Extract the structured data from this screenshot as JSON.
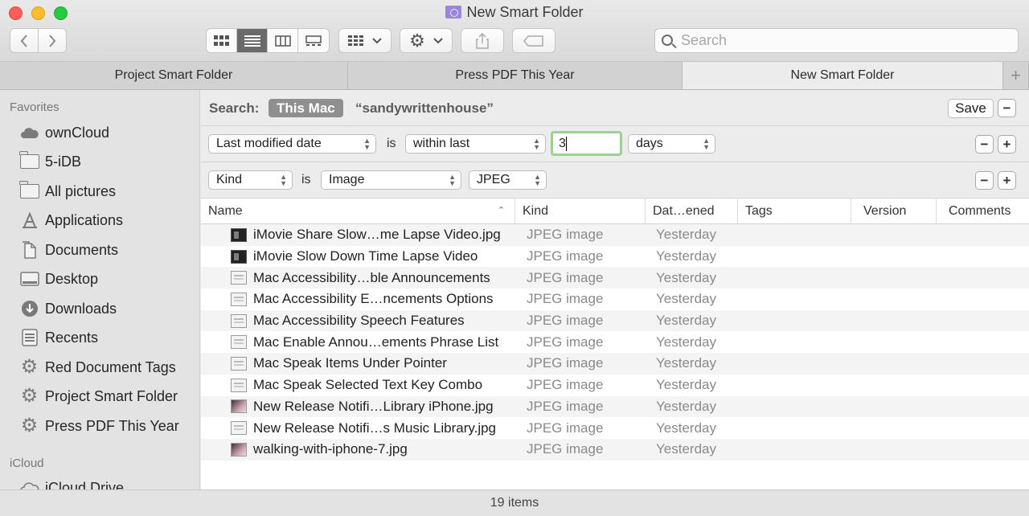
{
  "window": {
    "title": "New Smart Folder"
  },
  "toolbar": {
    "back_icon": "chevron-left-icon",
    "forward_icon": "chevron-right-icon",
    "view_modes": [
      "icon-view",
      "list-view",
      "column-view",
      "gallery-view"
    ],
    "active_view": "list-view",
    "search_placeholder": "Search"
  },
  "tabs": [
    {
      "label": "Project Smart Folder",
      "active": false
    },
    {
      "label": "Press PDF This Year",
      "active": false
    },
    {
      "label": "New Smart Folder",
      "active": true
    }
  ],
  "sidebar": {
    "favorites_header": "Favorites",
    "items": [
      {
        "label": "ownCloud",
        "icon": "cloud-icon"
      },
      {
        "label": "5-iDB",
        "icon": "folder-icon"
      },
      {
        "label": "All pictures",
        "icon": "folder-icon"
      },
      {
        "label": "Applications",
        "icon": "applications-icon"
      },
      {
        "label": "Documents",
        "icon": "document-icon"
      },
      {
        "label": "Desktop",
        "icon": "desktop-icon"
      },
      {
        "label": "Downloads",
        "icon": "download-icon"
      },
      {
        "label": "Recents",
        "icon": "recents-icon"
      },
      {
        "label": "Red Document Tags",
        "icon": "gear-icon"
      },
      {
        "label": "Project Smart Folder",
        "icon": "gear-icon"
      },
      {
        "label": "Press PDF This Year",
        "icon": "gear-icon"
      }
    ],
    "icloud_header": "iCloud",
    "icloud_items": [
      {
        "label": "iCloud Drive",
        "icon": "cloud-icon"
      }
    ]
  },
  "search_scope": {
    "label": "Search:",
    "this_mac": "This Mac",
    "user": "“sandywrittenhouse”",
    "save_label": "Save",
    "minus": "−",
    "plus": "+"
  },
  "criteria": [
    {
      "attribute": "Last modified date",
      "op_word": "is",
      "operator": "within last",
      "value": "3",
      "unit": "days"
    },
    {
      "attribute": "Kind",
      "op_word": "is",
      "operator": "Image",
      "unit": "JPEG"
    }
  ],
  "table": {
    "columns": [
      "Name",
      "Kind",
      "Dat…ened",
      "Tags",
      "Version",
      "Comments"
    ],
    "rows": [
      {
        "name": "iMovie Share Slow…me Lapse Video.jpg",
        "kind": "JPEG image",
        "date": "Yesterday",
        "thumb": "dark"
      },
      {
        "name": "iMovie Slow Down Time Lapse Video",
        "kind": "JPEG image",
        "date": "Yesterday",
        "thumb": "dark"
      },
      {
        "name": "Mac Accessibility…ble Announcements",
        "kind": "JPEG image",
        "date": "Yesterday",
        "thumb": "light"
      },
      {
        "name": "Mac Accessibility E…ncements Options",
        "kind": "JPEG image",
        "date": "Yesterday",
        "thumb": "light"
      },
      {
        "name": "Mac Accessibility Speech Features",
        "kind": "JPEG image",
        "date": "Yesterday",
        "thumb": "light"
      },
      {
        "name": "Mac Enable Annou…ements Phrase List",
        "kind": "JPEG image",
        "date": "Yesterday",
        "thumb": "light"
      },
      {
        "name": "Mac Speak Items Under Pointer",
        "kind": "JPEG image",
        "date": "Yesterday",
        "thumb": "light"
      },
      {
        "name": "Mac Speak Selected Text Key Combo",
        "kind": "JPEG image",
        "date": "Yesterday",
        "thumb": "light"
      },
      {
        "name": "New Release Notifi…Library iPhone.jpg",
        "kind": "JPEG image",
        "date": "Yesterday",
        "thumb": "photo"
      },
      {
        "name": "New Release Notifi…s Music Library.jpg",
        "kind": "JPEG image",
        "date": "Yesterday",
        "thumb": "light"
      },
      {
        "name": "walking-with-iphone-7.jpg",
        "kind": "JPEG image",
        "date": "Yesterday",
        "thumb": "photo"
      }
    ]
  },
  "status": {
    "item_count": "19 items"
  }
}
